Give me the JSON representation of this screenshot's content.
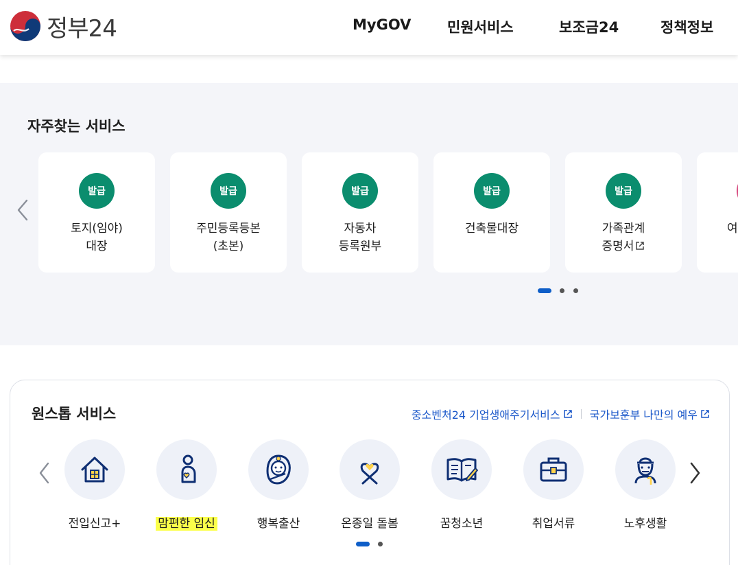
{
  "header": {
    "logo_text": "정부24",
    "nav": [
      "MyGOV",
      "민원서비스",
      "보조금24",
      "정책정보"
    ]
  },
  "frequent": {
    "title": "자주찾는 서비스",
    "badge": "발급",
    "cards": [
      {
        "label": "토지(임야)\n대장",
        "external": false
      },
      {
        "label": "주민등록등본\n(초본)",
        "external": false
      },
      {
        "label": "자동차\n등록원부",
        "external": false
      },
      {
        "label": "건축물대장",
        "external": false
      },
      {
        "label": "가족관계\n증명서",
        "external": true
      },
      {
        "label": "여",
        "external": false
      }
    ],
    "page_count": 3,
    "active_page": 1
  },
  "onestop": {
    "title": "원스톱 서비스",
    "links": [
      {
        "label": "중소벤처24 기업생애주기서비스"
      },
      {
        "label": "국가보훈부 나만의 예우"
      }
    ],
    "items": [
      {
        "label": "전입신고+",
        "icon": "house-icon",
        "highlighted": false
      },
      {
        "label": "맘편한 임신",
        "icon": "pregnancy-icon",
        "highlighted": true
      },
      {
        "label": "행복출산",
        "icon": "baby-icon",
        "highlighted": false
      },
      {
        "label": "온종일 돌봄",
        "icon": "heart-ribbon-icon",
        "highlighted": false
      },
      {
        "label": "꿈청소년",
        "icon": "book-icon",
        "highlighted": false
      },
      {
        "label": "취업서류",
        "icon": "briefcase-icon",
        "highlighted": false
      },
      {
        "label": "노후생활",
        "icon": "elder-icon",
        "highlighted": false
      }
    ],
    "page_count": 2,
    "active_page": 1
  },
  "colors": {
    "badge_green": "#0b8d6e",
    "link_blue": "#1a57c9",
    "active_dot": "#0e5ec8",
    "highlight": "#fbff4a",
    "section_bg": "#f4f5f9"
  }
}
